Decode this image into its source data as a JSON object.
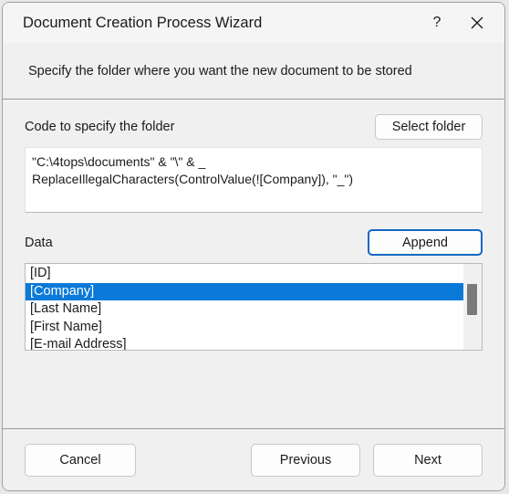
{
  "window": {
    "title": "Document Creation Process Wizard",
    "subtitle": "Specify the folder where you want the new document to be stored",
    "help_icon": "question-mark-icon",
    "close_icon": "close-icon"
  },
  "folder_section": {
    "label": "Code to specify the folder",
    "select_folder_label": "Select folder",
    "code_lines": [
      "\"C:\\4tops\\documents\" & \"\\\" & _",
      "ReplaceIllegalCharacters(ControlValue(![Company]), \"_\")"
    ]
  },
  "data_section": {
    "label": "Data",
    "append_label": "Append",
    "items": [
      {
        "label": "[ID]",
        "selected": false
      },
      {
        "label": "[Company]",
        "selected": true
      },
      {
        "label": "[Last Name]",
        "selected": false
      },
      {
        "label": "[First Name]",
        "selected": false
      },
      {
        "label": "[E-mail Address]",
        "selected": false
      }
    ],
    "selection_color": "#0a79d8"
  },
  "footer": {
    "cancel_label": "Cancel",
    "previous_label": "Previous",
    "next_label": "Next"
  }
}
